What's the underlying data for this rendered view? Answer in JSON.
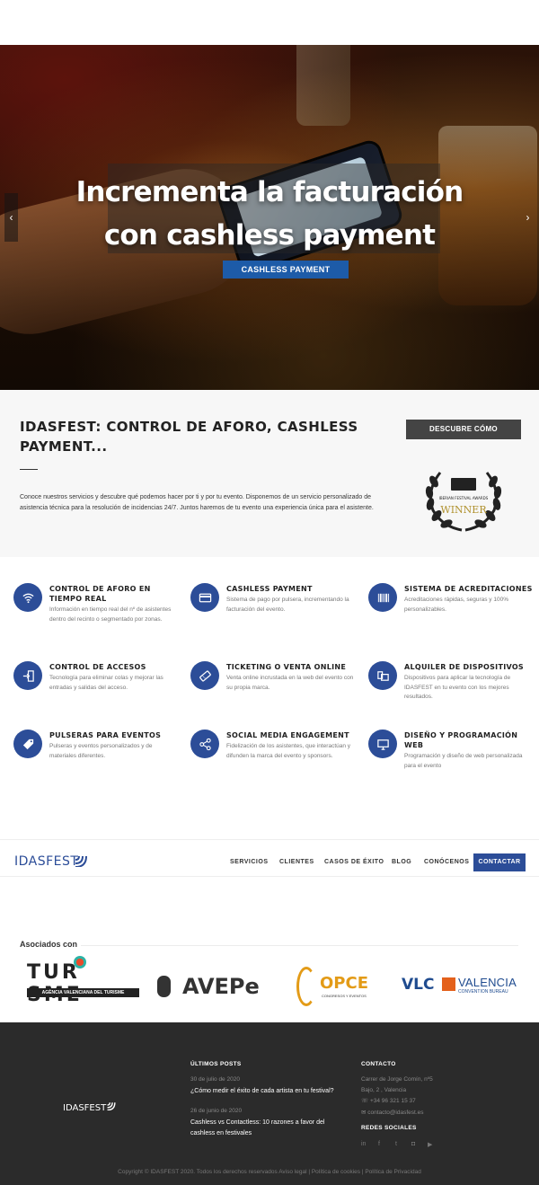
{
  "hero": {
    "title_line1": "Incrementa la facturación",
    "title_line2": "con cashless payment",
    "cta_label": "CASHLESS PAYMENT",
    "prev_arrow": "‹",
    "next_arrow": "›"
  },
  "intro": {
    "heading": "IDASFEST: CONTROL DE AFORO, CASHLESS PAYMENT...",
    "body": "Conoce nuestros servicios y descubre qué podemos hacer por ti y por tu evento. Disponemos de un servicio personalizado de asistencia técnica para la resolución de incidencias 24/7. Juntos haremos de tu evento una experiencia única para el asistente.",
    "discover_label": "DESCUBRE CÓMO",
    "award_caption": "IBERIAN FESTIVAL AWARDS",
    "award_word": "WINNER"
  },
  "services": [
    {
      "title": "CONTROL DE AFORO EN TIEMPO REAL",
      "desc": "Información en tiempo real del nº de asistentes dentro del recinto o segmentado por zonas.",
      "icon": "wifi-icon"
    },
    {
      "title": "CASHLESS PAYMENT",
      "desc": "Sistema de pago por pulsera, incrementando la facturación del evento.",
      "icon": "credit-card-icon"
    },
    {
      "title": "SISTEMA DE ACREDITACIONES",
      "desc": "Acreditaciones rápidas, seguras y 100% personalizables.",
      "icon": "barcode-icon"
    },
    {
      "title": "CONTROL DE ACCESOS",
      "desc": "Tecnología para eliminar colas y mejorar las entradas y salidas del acceso.",
      "icon": "door-enter-icon"
    },
    {
      "title": "TICKETING O VENTA ONLINE",
      "desc": "Venta online incrustada en la web del evento con su propia marca.",
      "icon": "ticket-icon"
    },
    {
      "title": "ALQUILER DE DISPOSITIVOS",
      "desc": "Dispositivos para aplicar la tecnología de IDASFEST en tu evento con los mejores resultados.",
      "icon": "devices-icon"
    },
    {
      "title": "PULSERAS PARA EVENTOS",
      "desc": "Pulseras y eventos personalizados y de materiales diferentes.",
      "icon": "tag-icon"
    },
    {
      "title": "SOCIAL MEDIA ENGAGEMENT",
      "desc": "Fidelización de los asistentes, que interactúan y difunden la marca del evento y sponsors.",
      "icon": "share-icon"
    },
    {
      "title": "DISEÑO Y PROGRAMACIÓN WEB",
      "desc": "Programación y diseño de web personalizada para el evento",
      "icon": "monitor-icon"
    }
  ],
  "nav": {
    "brand": "IDASFEST",
    "links": [
      "SERVICIOS",
      "CLIENTES",
      "CASOS DE ÉXITO",
      "BLOG",
      "CONÓCENOS"
    ],
    "contact_label": "CONTACTAR"
  },
  "partners": {
    "heading": "Asociados con",
    "turisme_main": "TUR SME",
    "turisme_sub": "AGÈNCIA VALENCIANA DEL TURISME",
    "avepe": "AVEPe",
    "opce": "OPCE",
    "opce_sub": "CONGRESOS Y EVENTOS",
    "vlc": "VLC",
    "valencia": "VALENCIA",
    "valencia_sub": "CONVENTION BUREAU"
  },
  "footer": {
    "brand": "IDASFEST",
    "posts_heading": "ÚLTIMOS POSTS",
    "posts": [
      {
        "date": "30 de julio de 2020",
        "title": "¿Cómo medir el éxito de cada artista en tu festival?"
      },
      {
        "date": "26 de junio de 2020",
        "title": "Cashless vs Contactless: 10 razones a favor del cashless en festivales"
      }
    ],
    "contact_heading": "CONTACTO",
    "address1": "Carrer de Jorge Comín, nº5",
    "address2": "Bajo, 2 , Valencia",
    "phone": "+34 96 321 15 37",
    "email": "contacto@idasfest.es",
    "social_heading": "REDES SOCIALES",
    "socials": [
      "in",
      "f",
      "t",
      "◘",
      "▶"
    ],
    "copyright": "Copyright © IDASFEST 2020. Todos los derechos reservados Aviso legal | Política de cookies | Política de Privacidad"
  }
}
